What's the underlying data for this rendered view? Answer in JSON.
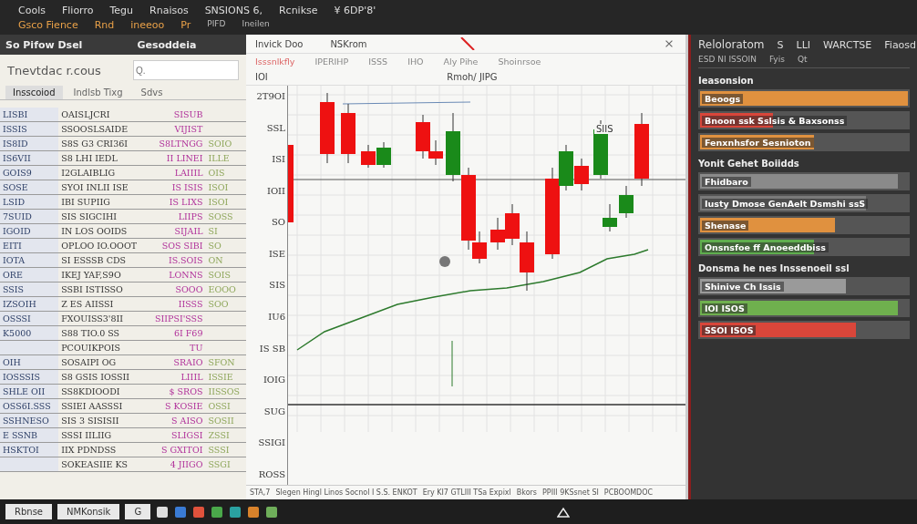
{
  "top_bar": {
    "menu_row_1": [
      "Cools",
      "Fliorro",
      "Tegu",
      "Rnaisos",
      "SNSIONS 6,",
      "Rcnikse",
      "¥ 6DP'8'"
    ],
    "menu_row_2": [
      "Gsco Fience",
      "Rnd",
      "ineeoo",
      "Pr"
    ],
    "right_labels": [
      "PIFD",
      "Ineilen"
    ]
  },
  "left_panel": {
    "toolbar": [
      "So Pifow Dsel",
      "Gesoddeia"
    ],
    "title": "Tnevtdac r.cous",
    "search_placeholder": "Q.",
    "tabs": [
      {
        "label": "Insscoiod",
        "selected": true
      },
      {
        "label": "Indlsb Tixg",
        "selected": false
      },
      {
        "label": "Sdvs",
        "selected": false
      }
    ],
    "rows": [
      [
        "LISBI",
        "OAISLJCRI",
        "SISUB",
        ""
      ],
      [
        "ISSIS",
        "SSOOSLSAIDE",
        "VIJIST",
        ""
      ],
      [
        "IS8ID",
        "S8S G3 CRI36I",
        "S8LTNGG",
        "SOIO"
      ],
      [
        "IS6VII",
        "S8 LHI IEDL",
        "II LINEI",
        "ILLE"
      ],
      [
        "GOIS9",
        "I2GLAIBLIG",
        "LAIIIL",
        "OIS"
      ],
      [
        "SOSE",
        "SYOI INLII ISE",
        "IS ISIS",
        "ISOI"
      ],
      [
        "LSID",
        "IBI SUPIIG",
        "IS LIXS",
        "ISOI"
      ],
      [
        "7SUID",
        "SIS SIGCIHI",
        "LIIPS",
        "SOSS"
      ],
      [
        "IGOID",
        "IN LOS OOIDS",
        "SIJAIL",
        "SI"
      ],
      [
        "EITI",
        "OPLOO IO.OOOT",
        "SOS SIBI",
        "SO"
      ],
      [
        "IOTA",
        "SI ESSSB CDS",
        "IS.SOIS",
        "ON"
      ],
      [
        "ORE",
        "IKEJ YAF,S9O",
        "LONNS",
        "SOIS"
      ],
      [
        "SSIS",
        "SSBI ISTISSO",
        "SOOO",
        "EOOO"
      ],
      [
        "IZSOIH",
        "Z ES AIISSI",
        "IISSS",
        "SOO"
      ],
      [
        "OSSSI",
        "FXOUISS3'8II",
        "SIIPSI'SSS",
        ""
      ],
      [
        "K5000",
        "S88 TIO.0 SS",
        "6I F69",
        ""
      ],
      [
        "",
        "PCOUIKPOIS",
        "TU",
        ""
      ],
      [
        "OIH",
        "SOSAIPI OG",
        "SRAIO",
        "SFON"
      ],
      [
        "IOSSSIS",
        "S8 GSIS IOSSII",
        "LIIIL",
        "ISSIE"
      ],
      [
        "SHLE OII",
        "SS8KDIOODI",
        "$ SROS",
        "IISSOS"
      ],
      [
        "OSS6I.SSS",
        "SSIEI AASSSI",
        "S KOSIE",
        "OSSI"
      ],
      [
        "SSHNESO",
        "SIS 3 SISISII",
        "S AISO",
        "SOSII"
      ],
      [
        "E SSNB",
        "SSSI IILIIG",
        "SLIGSI",
        "ZSSI"
      ],
      [
        "HSKTOI",
        "IIX PDNDSS",
        "S GXITOI",
        "SSSI"
      ],
      [
        "",
        "SOKEASIIE KS",
        "4 JIIGO",
        "SSGI"
      ]
    ]
  },
  "chart_window": {
    "title": "Invick Doo",
    "tab": "NSKrom",
    "toolbar": [
      "Isssnlkfly",
      "IPERIHP",
      "ISSS",
      "IHO",
      "Aly Pihe",
      "Shoinrsoe"
    ],
    "subtitle": "Rmoh/ JIPG",
    "corner_label": "IOI",
    "y_labels": [
      "2T9OI",
      "SSL",
      "ISI",
      "IOII",
      "SO",
      "ISE",
      "SIS",
      "IU6",
      "IS SB",
      "IOIG",
      "SUG",
      "SSIGI",
      "ROSS"
    ],
    "candle_label": "SIIS",
    "status": [
      "STA,7",
      "Slegen Hingl Linos Socnol I S.S. ENKOT",
      "Ery KI7 GTLIII TSa Expixl",
      "Bkors",
      "PPIIl 9KSsnet SI",
      "PCBOOMDOC"
    ]
  },
  "right_panel": {
    "title": "Reloloratom",
    "header": [
      "S",
      "LLI",
      "WARCTSE",
      "Fiaosd"
    ],
    "subheader": [
      "ESD NI ISSOIN",
      "Fyis",
      "Qt"
    ],
    "items": [
      {
        "kind": "heading",
        "text": "Ieasonsion"
      },
      {
        "kind": "bar",
        "label": "Beoogs",
        "level": 1.0,
        "color": "#e0913f"
      },
      {
        "kind": "bar",
        "label": "Bnoon ssk Sslsis & Baxsonss",
        "level": 0.35,
        "color": "#d9463a"
      },
      {
        "kind": "bar",
        "label": "Fenxnhsfor Sesnioton",
        "level": 0.55,
        "color": "#e0913f"
      },
      {
        "kind": "heading",
        "text": "Yonit Gehet Boiidds"
      },
      {
        "kind": "bar",
        "label": "Fhidbaro",
        "level": 0.95,
        "color": "#8a8a8a"
      },
      {
        "kind": "bar",
        "label": "Iusty Dmose GenAelt Dsmshi ssS",
        "level": 0.8,
        "color": "#7a7a7a"
      },
      {
        "kind": "bar",
        "label": "Shenase",
        "level": 0.65,
        "color": "#e0913f"
      },
      {
        "kind": "bar",
        "label": "Onsnsfoe ff Anoeeddbiss",
        "level": 0.55,
        "color": "#5fae4e"
      },
      {
        "kind": "heading",
        "text": "Donsma he nes Inssenoeil ssl"
      },
      {
        "kind": "bar",
        "label": "Shinive Ch Issis",
        "level": 0.7,
        "color": "#9a9a9a"
      },
      {
        "kind": "bar",
        "label": "IOI ISOS",
        "level": 0.95,
        "color": "#6fb04e"
      },
      {
        "kind": "bar",
        "label": "SSOI ISOS",
        "level": 0.75,
        "color": "#d9463a"
      }
    ]
  },
  "taskbar": {
    "buttons": [
      "Rbnse",
      "NMKonsik",
      "G"
    ]
  }
}
